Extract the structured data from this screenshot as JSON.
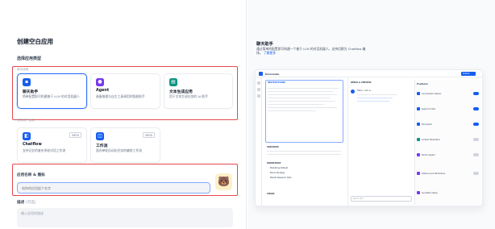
{
  "dialog": {
    "title": "创建空白应用",
    "app_type_label": "选择应用类型",
    "beginner_group": "新手适用",
    "advanced_group": "进阶用户适用",
    "cards": [
      {
        "id": "chatbot",
        "title": "聊天助手",
        "desc": "简单配置即可构建基于 LLM 的对话机器人",
        "icon": "chat-bubble-icon",
        "color": "#155eef",
        "selected": true
      },
      {
        "id": "agent",
        "title": "Agent",
        "desc": "具备推理与自主工具调用的智能助手",
        "icon": "agent-robot-icon",
        "color": "#7839ee",
        "selected": false
      },
      {
        "id": "text-gen",
        "title": "文本生成应用",
        "desc": "用于文本生成任务的 AI 助手",
        "icon": "document-icon",
        "color": "#0e9384",
        "selected": false
      },
      {
        "id": "chatflow",
        "title": "Chatflow",
        "desc": "支持记忆的复杂多轮对话工作流",
        "icon": "chatflow-icon",
        "color": "#155eef",
        "badge": "BETA",
        "selected": false
      },
      {
        "id": "workflow",
        "title": "工作流",
        "desc": "面向单轮自动化任务的编排工作流",
        "icon": "workflow-icon",
        "color": "#155eef",
        "badge": "BETA",
        "selected": false
      }
    ],
    "name_label": "应用名称 & 图标",
    "name_placeholder": "给你的应用起个名字",
    "emoji": "🐻",
    "desc_label": "描述",
    "desc_optional": "(可选)",
    "desc_placeholder": "输入应用的描述"
  },
  "preview": {
    "title": "聊天助手",
    "desc": "通过简单的配置即可构建一个基于 LLM 的对话机器人。支持切换为 Chatflow 编排。",
    "learn_more": "了解更多",
    "app_name": "Dorismate",
    "instructions": "INSTRUCTIONS",
    "debug_label": "DEBUG & PREVIEW",
    "features": "Features",
    "variables": "VARIABLES",
    "knowledge": "KNOWLEDGE",
    "vision": "VISION",
    "publish": "Publish",
    "feature_items": [
      "Conversation Opener",
      "Speech to Text",
      "File Upload",
      "Content Moderation",
      "Text to Speech",
      "Citations and Attributions",
      "Annotation Reply"
    ],
    "knowledge_items": [
      "Marketing Dataset",
      "Brand Strategy",
      "Market Research Data"
    ],
    "chat_greeting": "Hello, I am a...",
    "chat_input_placeholder": "Talk to Bot"
  }
}
